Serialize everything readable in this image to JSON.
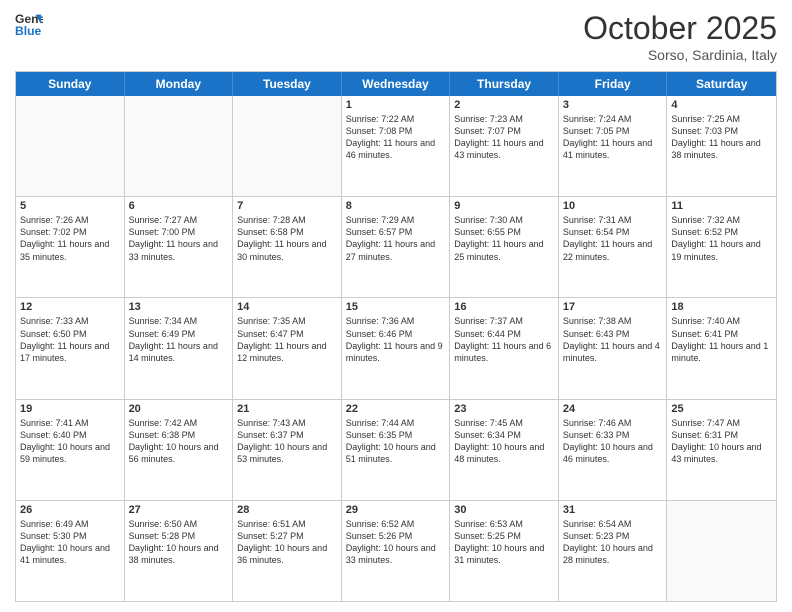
{
  "logo": {
    "line1": "General",
    "line2": "Blue"
  },
  "title": "October 2025",
  "subtitle": "Sorso, Sardinia, Italy",
  "days": [
    "Sunday",
    "Monday",
    "Tuesday",
    "Wednesday",
    "Thursday",
    "Friday",
    "Saturday"
  ],
  "weeks": [
    [
      {
        "day": "",
        "content": ""
      },
      {
        "day": "",
        "content": ""
      },
      {
        "day": "",
        "content": ""
      },
      {
        "day": "1",
        "content": "Sunrise: 7:22 AM\nSunset: 7:08 PM\nDaylight: 11 hours and 46 minutes."
      },
      {
        "day": "2",
        "content": "Sunrise: 7:23 AM\nSunset: 7:07 PM\nDaylight: 11 hours and 43 minutes."
      },
      {
        "day": "3",
        "content": "Sunrise: 7:24 AM\nSunset: 7:05 PM\nDaylight: 11 hours and 41 minutes."
      },
      {
        "day": "4",
        "content": "Sunrise: 7:25 AM\nSunset: 7:03 PM\nDaylight: 11 hours and 38 minutes."
      }
    ],
    [
      {
        "day": "5",
        "content": "Sunrise: 7:26 AM\nSunset: 7:02 PM\nDaylight: 11 hours and 35 minutes."
      },
      {
        "day": "6",
        "content": "Sunrise: 7:27 AM\nSunset: 7:00 PM\nDaylight: 11 hours and 33 minutes."
      },
      {
        "day": "7",
        "content": "Sunrise: 7:28 AM\nSunset: 6:58 PM\nDaylight: 11 hours and 30 minutes."
      },
      {
        "day": "8",
        "content": "Sunrise: 7:29 AM\nSunset: 6:57 PM\nDaylight: 11 hours and 27 minutes."
      },
      {
        "day": "9",
        "content": "Sunrise: 7:30 AM\nSunset: 6:55 PM\nDaylight: 11 hours and 25 minutes."
      },
      {
        "day": "10",
        "content": "Sunrise: 7:31 AM\nSunset: 6:54 PM\nDaylight: 11 hours and 22 minutes."
      },
      {
        "day": "11",
        "content": "Sunrise: 7:32 AM\nSunset: 6:52 PM\nDaylight: 11 hours and 19 minutes."
      }
    ],
    [
      {
        "day": "12",
        "content": "Sunrise: 7:33 AM\nSunset: 6:50 PM\nDaylight: 11 hours and 17 minutes."
      },
      {
        "day": "13",
        "content": "Sunrise: 7:34 AM\nSunset: 6:49 PM\nDaylight: 11 hours and 14 minutes."
      },
      {
        "day": "14",
        "content": "Sunrise: 7:35 AM\nSunset: 6:47 PM\nDaylight: 11 hours and 12 minutes."
      },
      {
        "day": "15",
        "content": "Sunrise: 7:36 AM\nSunset: 6:46 PM\nDaylight: 11 hours and 9 minutes."
      },
      {
        "day": "16",
        "content": "Sunrise: 7:37 AM\nSunset: 6:44 PM\nDaylight: 11 hours and 6 minutes."
      },
      {
        "day": "17",
        "content": "Sunrise: 7:38 AM\nSunset: 6:43 PM\nDaylight: 11 hours and 4 minutes."
      },
      {
        "day": "18",
        "content": "Sunrise: 7:40 AM\nSunset: 6:41 PM\nDaylight: 11 hours and 1 minute."
      }
    ],
    [
      {
        "day": "19",
        "content": "Sunrise: 7:41 AM\nSunset: 6:40 PM\nDaylight: 10 hours and 59 minutes."
      },
      {
        "day": "20",
        "content": "Sunrise: 7:42 AM\nSunset: 6:38 PM\nDaylight: 10 hours and 56 minutes."
      },
      {
        "day": "21",
        "content": "Sunrise: 7:43 AM\nSunset: 6:37 PM\nDaylight: 10 hours and 53 minutes."
      },
      {
        "day": "22",
        "content": "Sunrise: 7:44 AM\nSunset: 6:35 PM\nDaylight: 10 hours and 51 minutes."
      },
      {
        "day": "23",
        "content": "Sunrise: 7:45 AM\nSunset: 6:34 PM\nDaylight: 10 hours and 48 minutes."
      },
      {
        "day": "24",
        "content": "Sunrise: 7:46 AM\nSunset: 6:33 PM\nDaylight: 10 hours and 46 minutes."
      },
      {
        "day": "25",
        "content": "Sunrise: 7:47 AM\nSunset: 6:31 PM\nDaylight: 10 hours and 43 minutes."
      }
    ],
    [
      {
        "day": "26",
        "content": "Sunrise: 6:49 AM\nSunset: 5:30 PM\nDaylight: 10 hours and 41 minutes."
      },
      {
        "day": "27",
        "content": "Sunrise: 6:50 AM\nSunset: 5:28 PM\nDaylight: 10 hours and 38 minutes."
      },
      {
        "day": "28",
        "content": "Sunrise: 6:51 AM\nSunset: 5:27 PM\nDaylight: 10 hours and 36 minutes."
      },
      {
        "day": "29",
        "content": "Sunrise: 6:52 AM\nSunset: 5:26 PM\nDaylight: 10 hours and 33 minutes."
      },
      {
        "day": "30",
        "content": "Sunrise: 6:53 AM\nSunset: 5:25 PM\nDaylight: 10 hours and 31 minutes."
      },
      {
        "day": "31",
        "content": "Sunrise: 6:54 AM\nSunset: 5:23 PM\nDaylight: 10 hours and 28 minutes."
      },
      {
        "day": "",
        "content": ""
      }
    ]
  ]
}
